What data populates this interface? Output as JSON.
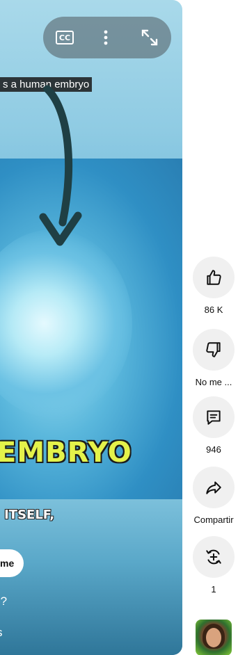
{
  "video": {
    "caption_top": "s a human embryo",
    "overlay_title": "EMBRYO",
    "overlay_subtitle": "NG ITSELF,",
    "chip_label": "me",
    "question_text": "nking?",
    "secondary_text": "s"
  },
  "controls": {
    "cc_label": "CC"
  },
  "actions": {
    "like_count": "86 K",
    "dislike_label": "No me ...",
    "comments_count": "946",
    "share_label": "Compartir",
    "remix_count": "1"
  },
  "colors": {
    "title_yellow": "#e4f24a",
    "arrow_dark": "#1f3f44",
    "rail_button_bg": "#f0f0f0"
  }
}
